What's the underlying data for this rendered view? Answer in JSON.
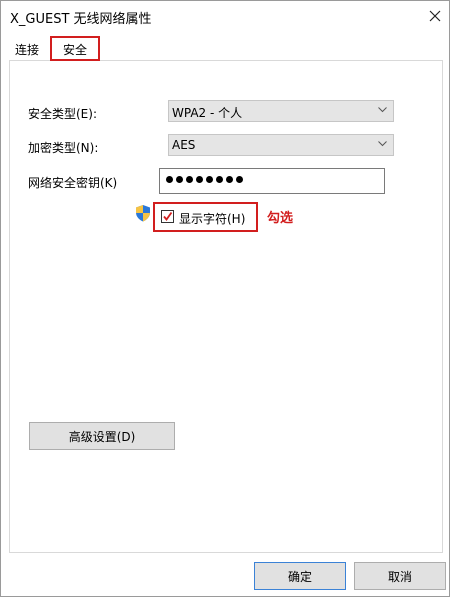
{
  "window": {
    "title": "X_GUEST 无线网络属性"
  },
  "tabs": [
    {
      "label": "连接"
    },
    {
      "label": "安全"
    }
  ],
  "security": {
    "type_label": "安全类型(E):",
    "type_value": "WPA2 - 个人",
    "encryption_label": "加密类型(N):",
    "encryption_value": "AES",
    "key_label": "网络安全密钥(K)",
    "key_masked_count": 8,
    "show_chars_label": "显示字符(H)",
    "show_chars_checked": true
  },
  "annotation": {
    "text": "勾选",
    "color": "#d21e1e"
  },
  "buttons": {
    "advanced": "高级设置(D)",
    "ok": "确定",
    "cancel": "取消"
  },
  "colors": {
    "highlight": "#d21e1e",
    "default_button_border": "#3b82d6"
  }
}
